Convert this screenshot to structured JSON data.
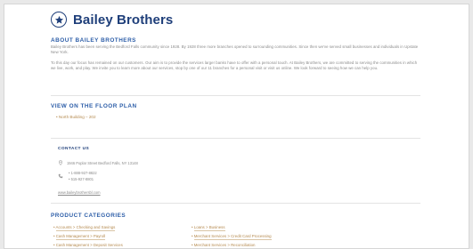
{
  "header": {
    "title": "Bailey Brothers",
    "icon": "star-icon",
    "brand_color": "#1f3f7a"
  },
  "about": {
    "heading": "ABOUT BAILEY BROTHERS",
    "paragraph1": "Bailey Brothers has been serving the Bedford Falls community since 1928. By 1928 three more branches opened to surrounding communities. Since then we've served small businesses and individuals in Upstate New York.",
    "paragraph2": "To this day our focus has remained on our customers. Our aim is to provide the services larger banks have to offer with a personal touch. At Bailey Brothers, we are committed to serving the communities in which we live, work, and play. We invite you to learn more about our services, stop by one of our 11 branches for a personal visit or visit us online. We look forward to seeing how we can help you."
  },
  "floor_plan": {
    "heading": "VIEW ON THE FLOOR PLAN",
    "link": "North Building – 202"
  },
  "contact": {
    "heading": "CONTACT US",
    "address": "1946 Poplar Street Bedford Falls, NY 13148",
    "phone1": "1-888-927-8822",
    "phone2": "515-927-8801",
    "website": "www.baileybrothersbl.com"
  },
  "categories": {
    "heading": "PRODUCT CATEGORIES",
    "left": [
      "Accounts > Checking and Savings",
      "Cash Management > Payroll",
      "Cash Management > Deposit Services"
    ],
    "right": [
      "Loans > Business",
      "Merchant Services > Credit Card Processing",
      "Merchant Services > Reconciliation"
    ]
  }
}
